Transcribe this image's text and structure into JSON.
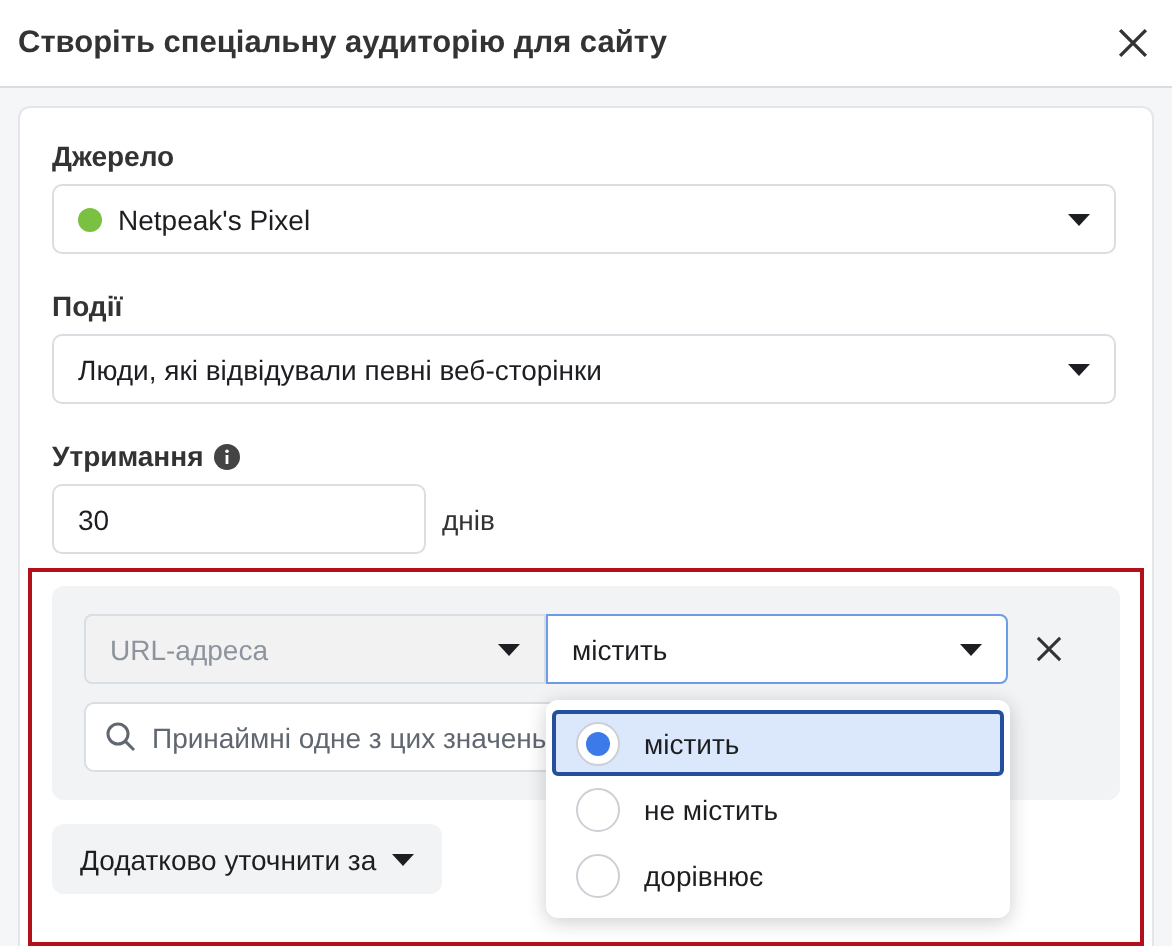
{
  "dialog": {
    "title": "Створіть спеціальну аудиторію для сайту"
  },
  "source": {
    "label": "Джерело",
    "value": "Netpeak's Pixel",
    "color": "#7ac142"
  },
  "events": {
    "label": "Події",
    "value": "Люди, які відвідували певні веб-сторінки"
  },
  "retention": {
    "label": "Утримання",
    "value": "30",
    "unit": "днів"
  },
  "rule": {
    "field": "URL-адреса",
    "operator": "містить",
    "search": {
      "placeholder": "Принаймні одне з цих значень"
    },
    "options": [
      {
        "label": "містить",
        "selected": true
      },
      {
        "label": "не містить",
        "selected": false
      },
      {
        "label": "дорівнює",
        "selected": false
      }
    ]
  },
  "refine_button": "Додатково уточнити за"
}
